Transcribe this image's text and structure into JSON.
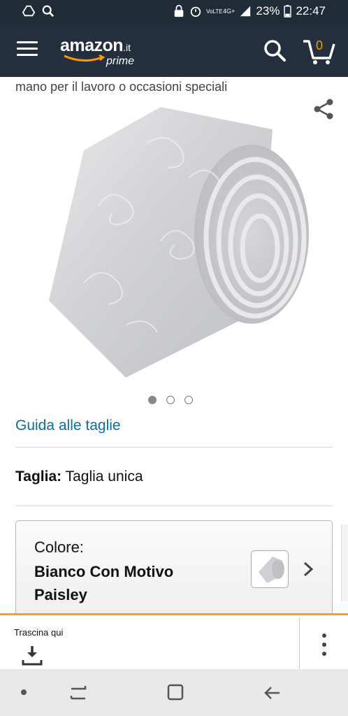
{
  "status_bar": {
    "battery": "23%",
    "time": "22:47",
    "network": "4G+",
    "volte": "VoLTE"
  },
  "header": {
    "logo_main": "amazon",
    "logo_tld": ".it",
    "logo_sub": "prime",
    "cart_count": "0"
  },
  "product": {
    "description_tail": "mano per il lavoro o occasioni speciali",
    "image_count": 3,
    "active_image_index": 0
  },
  "size_guide": {
    "link": "Guida alle taglie"
  },
  "size": {
    "label": "Taglia:",
    "value": "Taglia unica"
  },
  "color": {
    "label": "Colore:",
    "value": "Bianco Con Motivo Paisley"
  },
  "dock": {
    "label": "Trascina qui"
  },
  "colors": {
    "header_bg": "#232f3e",
    "status_bg": "#1f2b36",
    "link": "#0f6ba0",
    "accent": "#f90"
  }
}
